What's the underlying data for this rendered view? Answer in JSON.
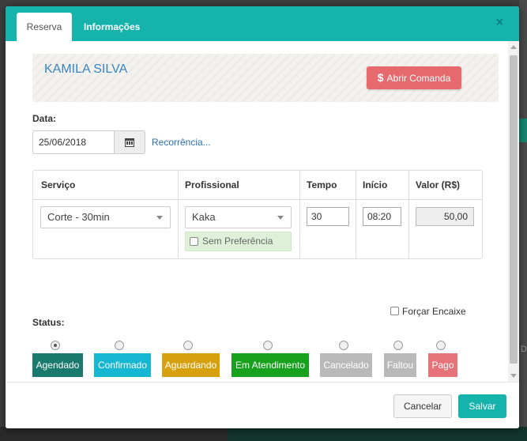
{
  "tabs": [
    {
      "label": "Reserva"
    },
    {
      "label": "Informações"
    }
  ],
  "close_icon_glyph": "×",
  "client": {
    "name": "KAMILA SILVA"
  },
  "comanda_button": {
    "icon": "$",
    "label": "Abrir Comanda"
  },
  "date": {
    "label": "Data:",
    "value": "25/06/2018",
    "calendar_icon": "calendar-icon",
    "recurrence_link": "Recorrência..."
  },
  "service_table": {
    "headers": [
      "Serviço",
      "Profissional",
      "Tempo",
      "Início",
      "Valor (R$)"
    ],
    "row": {
      "service": "Corte - 30min",
      "professional": "Kaka",
      "no_preference_label": "Sem Preferência",
      "time": "30",
      "start": "08:20",
      "value": "50,00"
    }
  },
  "force_fit_label": "Forçar Encaixe",
  "status": {
    "label": "Status:",
    "selected": "Agendado",
    "options": [
      {
        "label": "Agendado",
        "color": "#1a7a6e"
      },
      {
        "label": "Confirmado",
        "color": "#15b7d2"
      },
      {
        "label": "Aguardando",
        "color": "#d7a00e"
      },
      {
        "label": "Em Atendimento",
        "color": "#16a21d"
      },
      {
        "label": "Cancelado",
        "color": "#b9b9b9"
      },
      {
        "label": "Faltou",
        "color": "#b9b9b9"
      },
      {
        "label": "Pago",
        "color": "#e6727a"
      }
    ]
  },
  "footer": {
    "cancel_label": "Cancelar",
    "save_label": "Salvar"
  },
  "colors": {
    "accent": "#15b3ac",
    "danger": "#e66a6d",
    "link": "#2a6fb0"
  }
}
